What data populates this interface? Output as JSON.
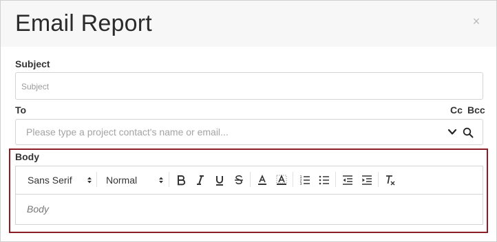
{
  "dialog": {
    "title": "Email Report",
    "close_symbol": "×"
  },
  "subject": {
    "label": "Subject",
    "placeholder": "Subject"
  },
  "to": {
    "label": "To",
    "cc_label": "Cc",
    "bcc_label": "Bcc",
    "placeholder": "Please type a project contact's name or email..."
  },
  "body": {
    "label": "Body",
    "placeholder": "Body",
    "font_select": "Sans Serif",
    "size_select": "Normal",
    "toolbar_buttons": [
      "bold-icon",
      "italic-icon",
      "underline-icon",
      "strikethrough-icon",
      "text-color-icon",
      "background-color-icon",
      "ordered-list-icon",
      "bullet-list-icon",
      "outdent-icon",
      "indent-icon",
      "clear-formatting-icon"
    ]
  },
  "colors": {
    "highlight_border": "#8b1c24",
    "header_bg": "#f7f7f7",
    "input_border": "#d4d4d4"
  }
}
